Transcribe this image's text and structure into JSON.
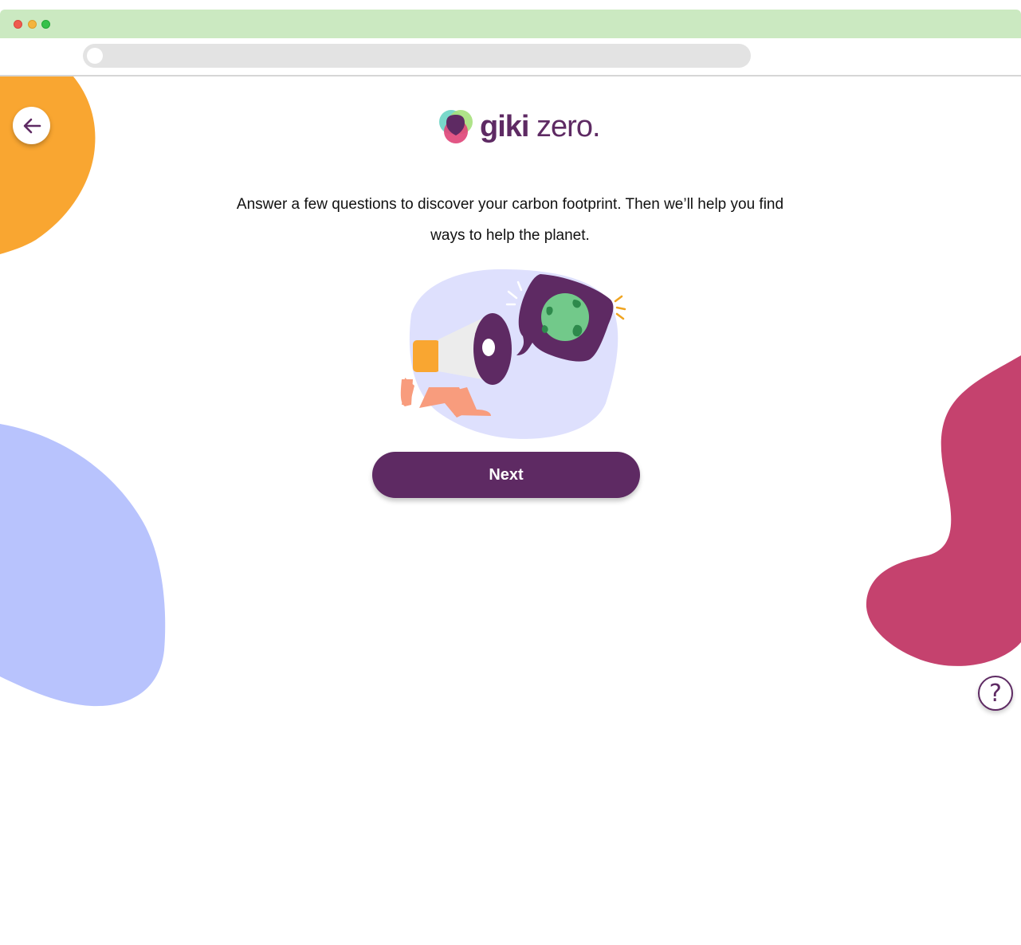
{
  "browser": {
    "url": ""
  },
  "brand": {
    "name_bold": "giki",
    "name_light": " zero."
  },
  "intro": {
    "text": "Answer a few questions to discover your carbon footprint. Then we’ll help you find ways to help the planet."
  },
  "actions": {
    "next_label": "Next",
    "help_label": "?"
  },
  "icons": {
    "back": "arrow-left-icon",
    "help": "question-mark-icon",
    "logo": "giki-logo-icon",
    "illustration": "megaphone-globe-illustration"
  },
  "colors": {
    "brand_purple": "#5e2a63",
    "orange_blob": "#f9a631",
    "lavender_blob": "#b8c3fd",
    "pink_blob": "#c5426e",
    "chrome_green": "#cbe9c1"
  }
}
